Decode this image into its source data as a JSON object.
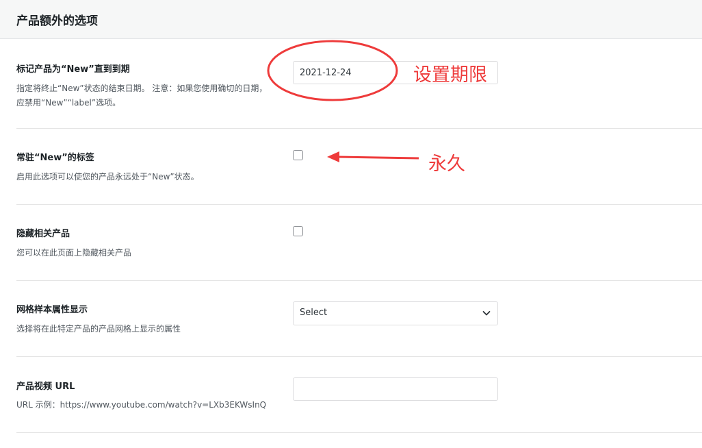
{
  "header": {
    "title": "产品额外的选项"
  },
  "rows": [
    {
      "title": "标记产品为“New”直到到期",
      "desc": "指定将终止“New”状态的结束日期。 注意：如果您使用确切的日期，应禁用“New”“label”选项。",
      "value": "2021-12-24"
    },
    {
      "title": "常驻“New”的标签",
      "desc": "启用此选项可以使您的产品永远处于“New”状态。",
      "checked": false
    },
    {
      "title": "隐藏相关产品",
      "desc": "您可以在此页面上隐藏相关产品",
      "checked": false
    },
    {
      "title": "网格样本属性显示",
      "desc": "选择将在此特定产品的产品网格上显示的属性",
      "selected": "Select"
    },
    {
      "title": "产品视频 URL",
      "desc": "URL 示例：https://www.youtube.com/watch?v=LXb3EKWsInQ",
      "value": ""
    }
  ],
  "annotations": {
    "date_note": "设置期限",
    "permanent_note": "永久",
    "color": "#ee3b3b"
  }
}
